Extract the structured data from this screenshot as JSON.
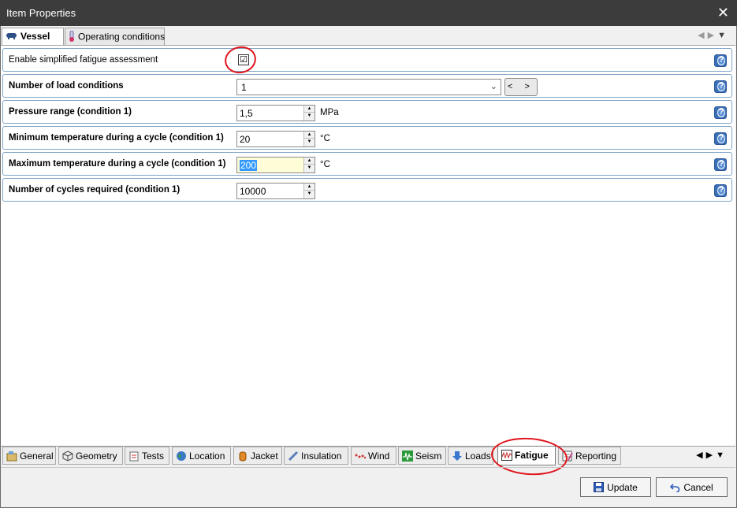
{
  "window": {
    "title": "Item Properties"
  },
  "top_tabs": [
    {
      "label": "Vessel",
      "active": true
    },
    {
      "label": "Operating conditions",
      "active": false
    }
  ],
  "rows": {
    "fatigue": {
      "label": "Enable simplified fatigue assessment",
      "checked": true,
      "check_glyph": "☑"
    },
    "load_conditions": {
      "label": "Number of load conditions",
      "value": "1",
      "nav": "< >"
    },
    "pressure_range": {
      "label": "Pressure range (condition 1)",
      "value": "1,5",
      "unit": "MPa"
    },
    "min_temp": {
      "label": "Minimum temperature during a cycle (condition 1)",
      "value": "20",
      "unit": "°C"
    },
    "max_temp": {
      "label": "Maximum temperature during a cycle (condition 1)",
      "value": "200",
      "unit": "°C"
    },
    "cycles": {
      "label": "Number of cycles required (condition 1)",
      "value": "10000"
    }
  },
  "bottom_tabs": [
    {
      "label": "General",
      "icon": "general-icon"
    },
    {
      "label": "Geometry",
      "icon": "geometry-icon"
    },
    {
      "label": "Tests",
      "icon": "tests-icon"
    },
    {
      "label": "Location",
      "icon": "globe-icon"
    },
    {
      "label": "Jacket",
      "icon": "jacket-icon"
    },
    {
      "label": "Insulation",
      "icon": "insulation-icon"
    },
    {
      "label": "Wind",
      "icon": "wind-icon"
    },
    {
      "label": "Seism",
      "icon": "seism-icon"
    },
    {
      "label": "Loads",
      "icon": "loads-icon"
    },
    {
      "label": "Fatigue",
      "icon": "fatigue-icon",
      "active": true
    },
    {
      "label": "Reporting",
      "icon": "reporting-icon"
    }
  ],
  "buttons": {
    "update": "Update",
    "cancel": "Cancel"
  },
  "colors": {
    "titlebar": "#3c3c3c",
    "row_border": "#7fa4c8",
    "annotation": "#e0141c",
    "help": "#3a6fb8"
  }
}
